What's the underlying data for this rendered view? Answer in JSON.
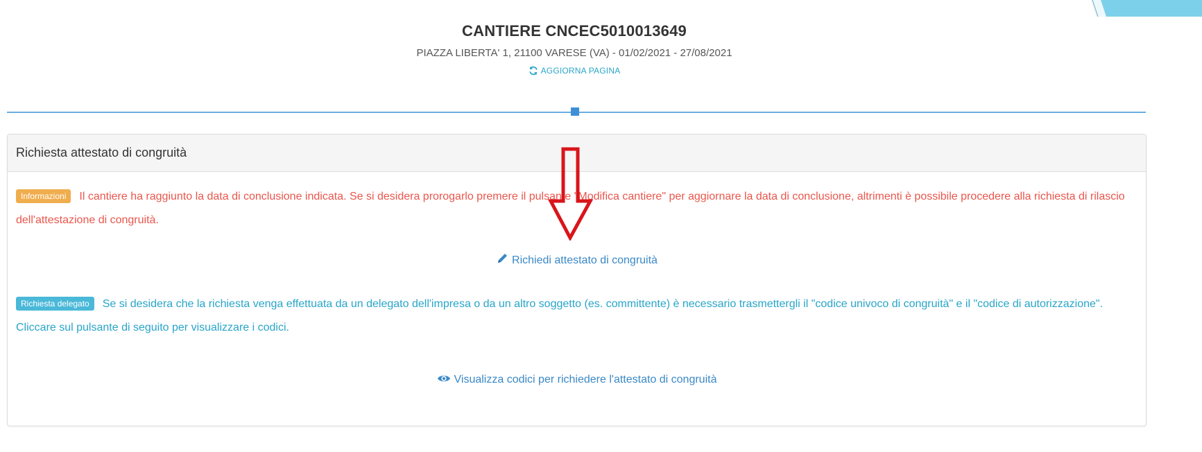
{
  "header": {
    "title": "CANTIERE CNCEC5010013649",
    "subtitle": "PIAZZA LIBERTA' 1, 21100 VARESE (VA) - 01/02/2021 - 27/08/2021",
    "refresh_label": "AGGIORNA PAGINA"
  },
  "panel": {
    "heading": "Richiesta attestato di congruità",
    "info": {
      "badge": "Informazioni",
      "text": "Il cantiere ha raggiunto la data di conclusione indicata. Se si desidera prorogarlo premere il pulsante \"Modifica cantiere\" per aggiornare la data di conclusione, altrimenti è possibile procedere alla richiesta di rilascio dell'attestazione di congruità."
    },
    "request_link": "Richiedi attestato di congruità",
    "delegate": {
      "badge": "Richiesta delegato",
      "text": "Se si desidera che la richiesta venga effettuata da un delegato dell'impresa o da un altro soggetto (es. committente) è necessario trasmettergli il \"codice univoco di congruità\" e il \"codice di autorizzazione\". Cliccare sul pulsante di seguito per visualizzare i codici."
    },
    "codes_link": "Visualizza codici per richiedere l'attestato di congruità"
  },
  "colors": {
    "accent": "#2aa5c8",
    "link": "#3a88c5",
    "warning_text": "#e9564c",
    "warning_badge": "#f0ad4e",
    "info_badge": "#4ab8d8",
    "annotation_arrow": "#d9151b"
  },
  "icons": {
    "refresh": "refresh-icon",
    "pencil": "pencil-icon",
    "eye": "eye-icon",
    "annotation": "down-arrow-annotation"
  }
}
